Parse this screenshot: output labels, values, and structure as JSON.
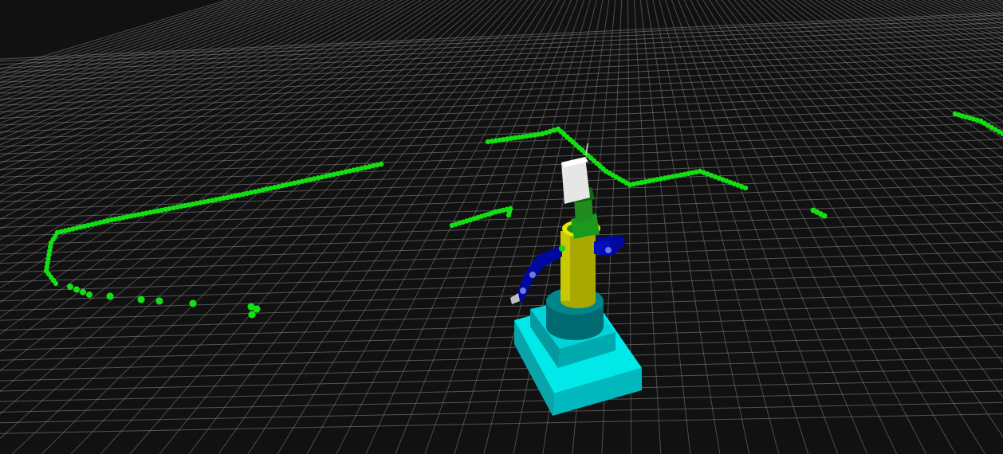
{
  "viewport": {
    "background_color": "#111111",
    "grid_color": "#8a8a8a",
    "laser_scan_color": "#13e013",
    "icon": "3d-scene-viewport"
  },
  "robot": {
    "base_color": "#00e5e5",
    "turret_color": "#007a80",
    "column_color": "#b5b500",
    "head_color": "#1a8a1a",
    "sensor_color": "#e6e6e6",
    "arm_color": "#0010b0"
  }
}
